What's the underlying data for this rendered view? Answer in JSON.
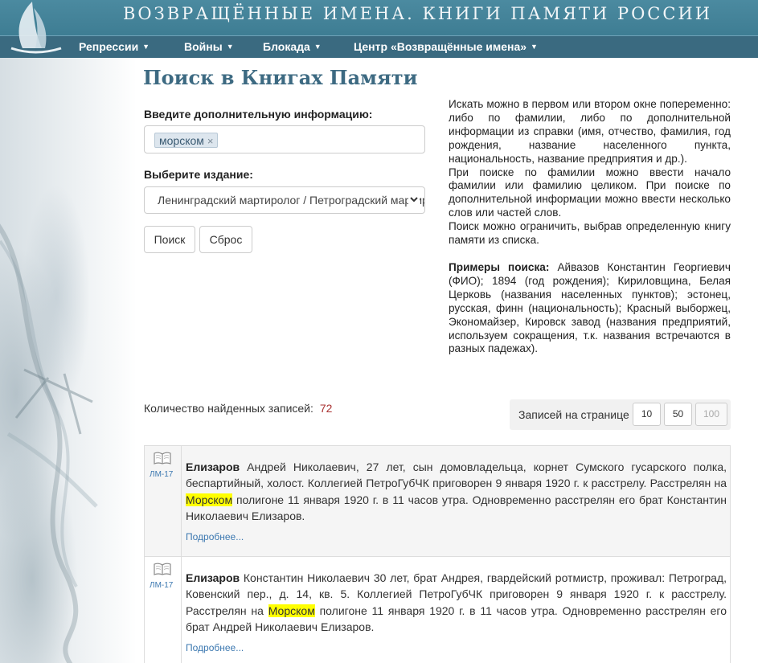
{
  "header": {
    "title": "ВОЗВРАЩЁННЫЕ ИМЕНА. КНИГИ ПАМЯТИ РОССИИ",
    "logo_icon": "sailboat-logo-icon"
  },
  "nav": {
    "items": [
      {
        "label": "Репрессии"
      },
      {
        "label": "Войны"
      },
      {
        "label": "Блокада"
      },
      {
        "label": "Центр «Возвращённые имена»"
      }
    ]
  },
  "page_title": "Поиск в Книгах Памяти",
  "form": {
    "info_label": "Введите дополнительную информацию:",
    "tag_value": "морском",
    "tag_remove": "×",
    "edition_label": "Выберите издание:",
    "edition_selected": "Ленинградский мартиролог / Петроградский мартиролог",
    "search_button": "Поиск",
    "reset_button": "Сброс"
  },
  "help": {
    "p1": "Искать можно в первом или втором окне попеременно: либо по фамилии, либо по дополнительной информации из справки (имя, отчество, фамилия, год рождения, название населенного пункта, национальность, название предприятия и др.).",
    "p2": "При поиске по фамилии можно ввести начало фамилии или фамилию целиком. При поиске по дополнительной информации можно ввести несколько слов или частей слов.",
    "p3": "Поиск можно ограничить, выбрав определенную книгу памяти из списка.",
    "examples_label": "Примеры поиска:",
    "examples_text": "Айвазов Константин Георгиевич (ФИО); 1894 (год рождения); Кириловщина, Белая Церковь (названия населенных пунктов); эстонец, русская, финн (национальность); Красный выборжец, Экономайзер, Кировск завод (названия предприятий, используем сокращения, т.к. названия встречаются в разных падежах)."
  },
  "results_count": {
    "label": "Количество найденных записей:",
    "value": "72"
  },
  "pager": {
    "label": "Записей на странице",
    "options": [
      "10",
      "50",
      "100"
    ],
    "disabled_option": "100"
  },
  "results": [
    {
      "book_code": "ЛМ-17",
      "surname": "Елизаров",
      "text_before": " Андрей Николаевич, 27 лет, сын домовладельца, корнет Сумского гусарского полка, беспартийный, холост. Коллегией ПетроГубЧК приговорен 9 января 1920 г. к расстрелу. Расстрелян на ",
      "highlight": "Морском",
      "text_after": " полигоне 11 января 1920 г. в 11 часов утра. Одновременно расстрелян его брат Константин Николаевич Елизаров.",
      "more": "Подробнее..."
    },
    {
      "book_code": "ЛМ-17",
      "surname": "Елизаров",
      "text_before": " Константин Николаевич 30 лет, брат Андрея, гвардейский ротмистр, проживал: Петроград, Ковенский пер., д. 14, кв. 5. Коллегией ПетроГубЧК приговорен 9 января 1920 г. к расстрелу. Расстрелян на ",
      "highlight": "Морском",
      "text_after": " полигоне 11 января 1920 г. в 11 часов утра. Одновременно расстрелян его брат Андрей Николаевич Елизаров.",
      "more": "Подробнее..."
    }
  ],
  "colors": {
    "header_bg": "#4b8aa0",
    "navbar_bg": "#3a6a80",
    "title_color": "#3d6a82",
    "link_color": "#3c78b0",
    "highlight": "#ffff00",
    "count_color": "#aa3333"
  }
}
